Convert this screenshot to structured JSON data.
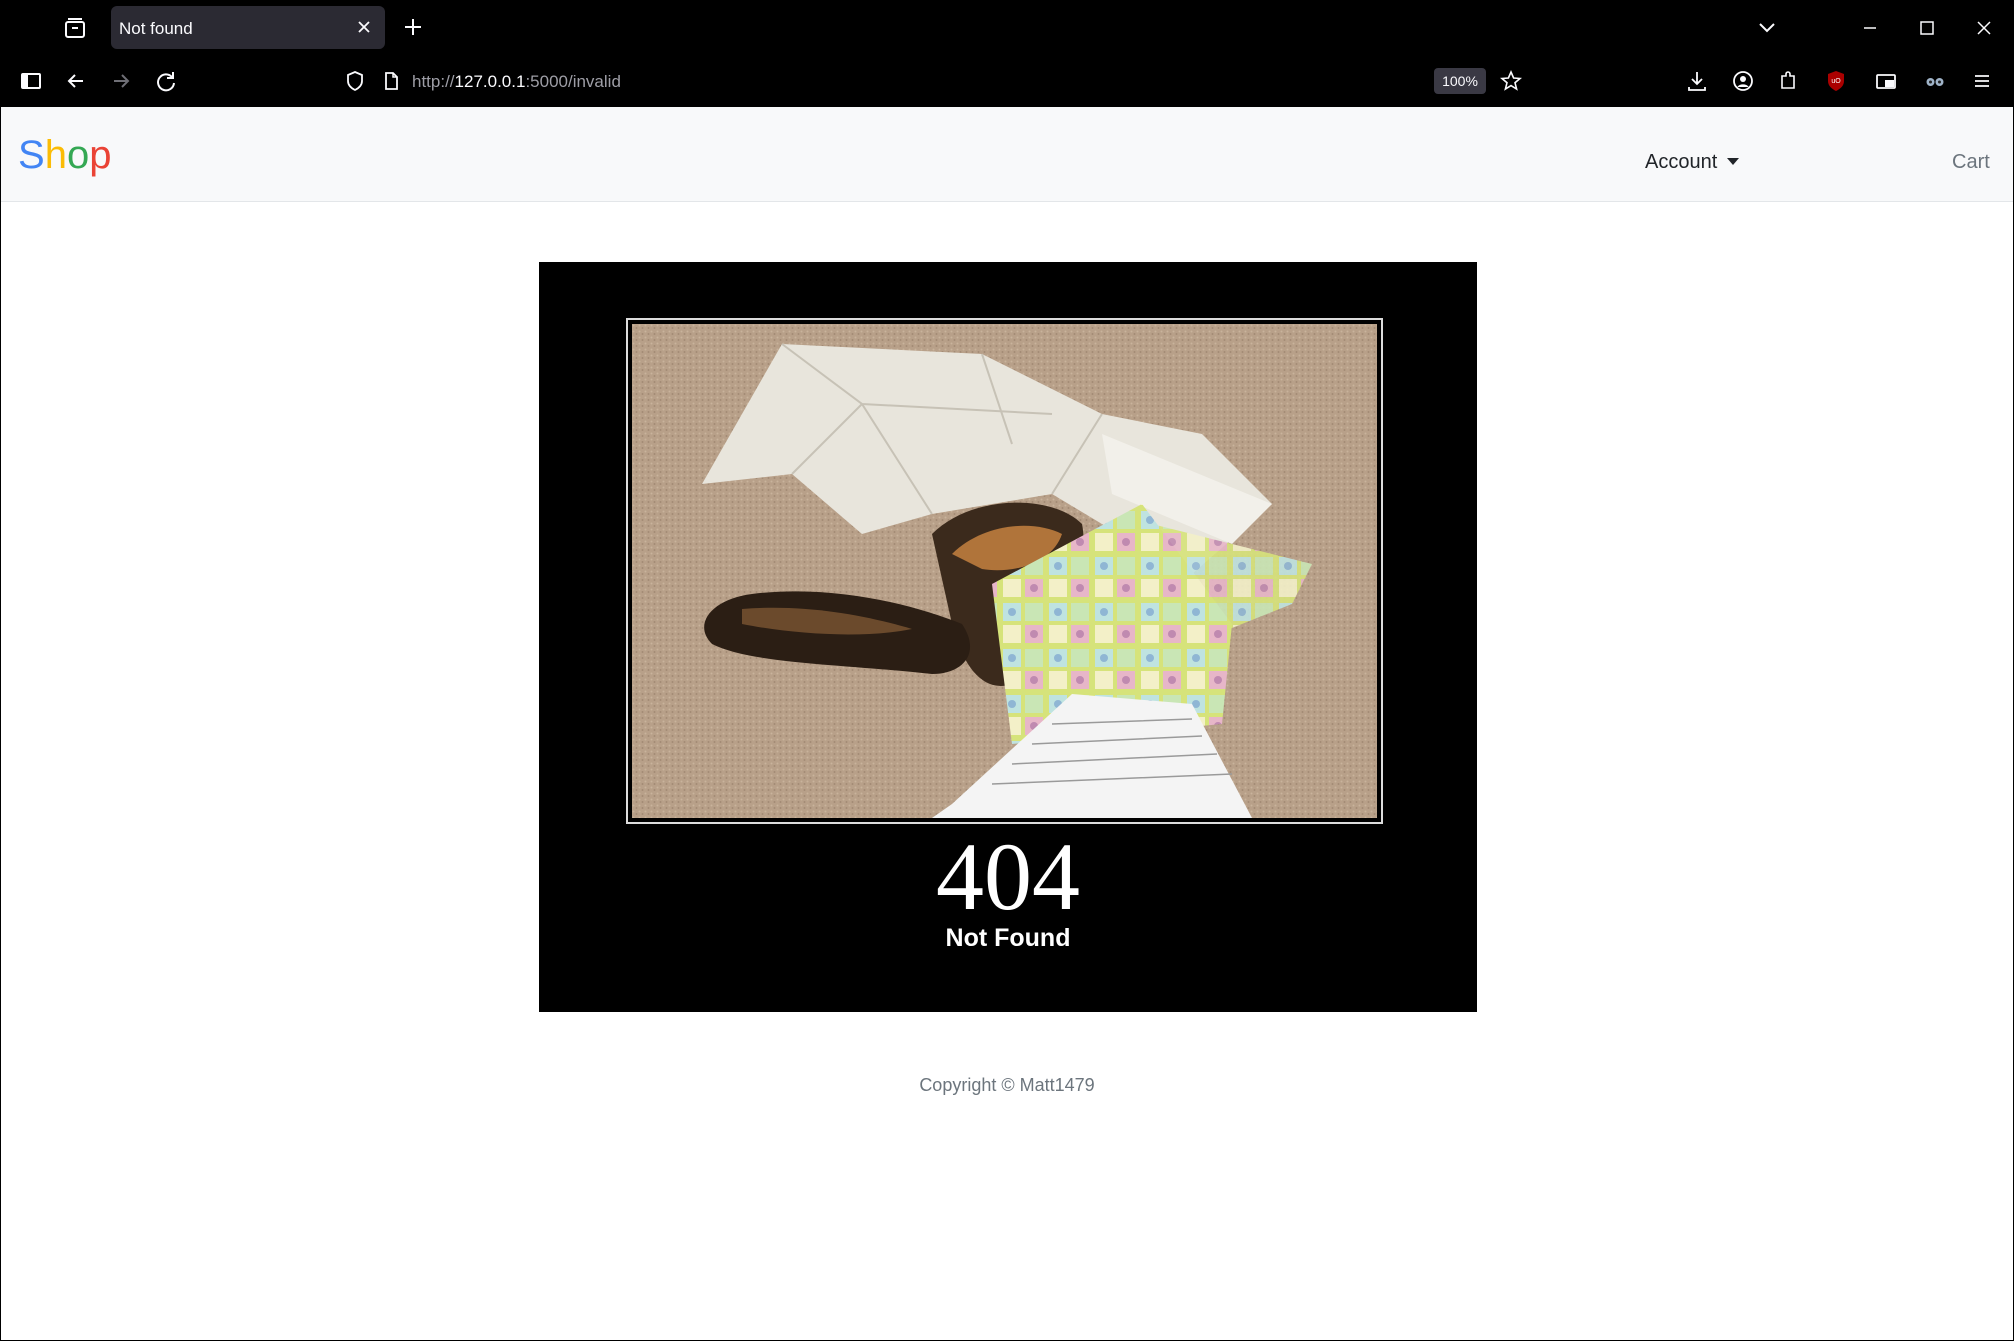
{
  "browser": {
    "tab_title": "Not found",
    "url_scheme": "http://",
    "url_host": "127.0.0.1",
    "url_rest": ":5000/invalid",
    "zoom": "100%"
  },
  "site": {
    "brand_letters": [
      {
        "char": "S",
        "color": "#4285f4"
      },
      {
        "char": "h",
        "color": "#fbbc05"
      },
      {
        "char": "o",
        "color": "#34a853"
      },
      {
        "char": "p",
        "color": "#ea4335"
      }
    ],
    "account_label": "Account",
    "cart_label": "Cart"
  },
  "error": {
    "code": "404",
    "message": "Not Found"
  },
  "footer": {
    "copyright": "Copyright © Matt1479"
  }
}
